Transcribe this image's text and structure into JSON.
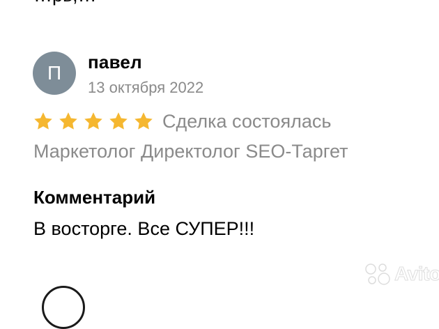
{
  "previous_review": {
    "cut_text": "…рь,…"
  },
  "review": {
    "avatar_letter": "П",
    "author": "павел",
    "date": "13 октября 2022",
    "rating": 5,
    "rating_max": 5,
    "star_color": "#f5b730",
    "deal_status": "Сделка состоялась",
    "service": "Маркетолог Директолог SEO-Таргет",
    "comment_title": "Комментарий",
    "comment_text": "В восторге. Все СУПЕР!!!"
  },
  "watermark": {
    "text": "Avito"
  },
  "colors": {
    "avatar_bg": "#7e8d98",
    "muted_text": "#8a8a8a",
    "main_text": "#000000"
  }
}
